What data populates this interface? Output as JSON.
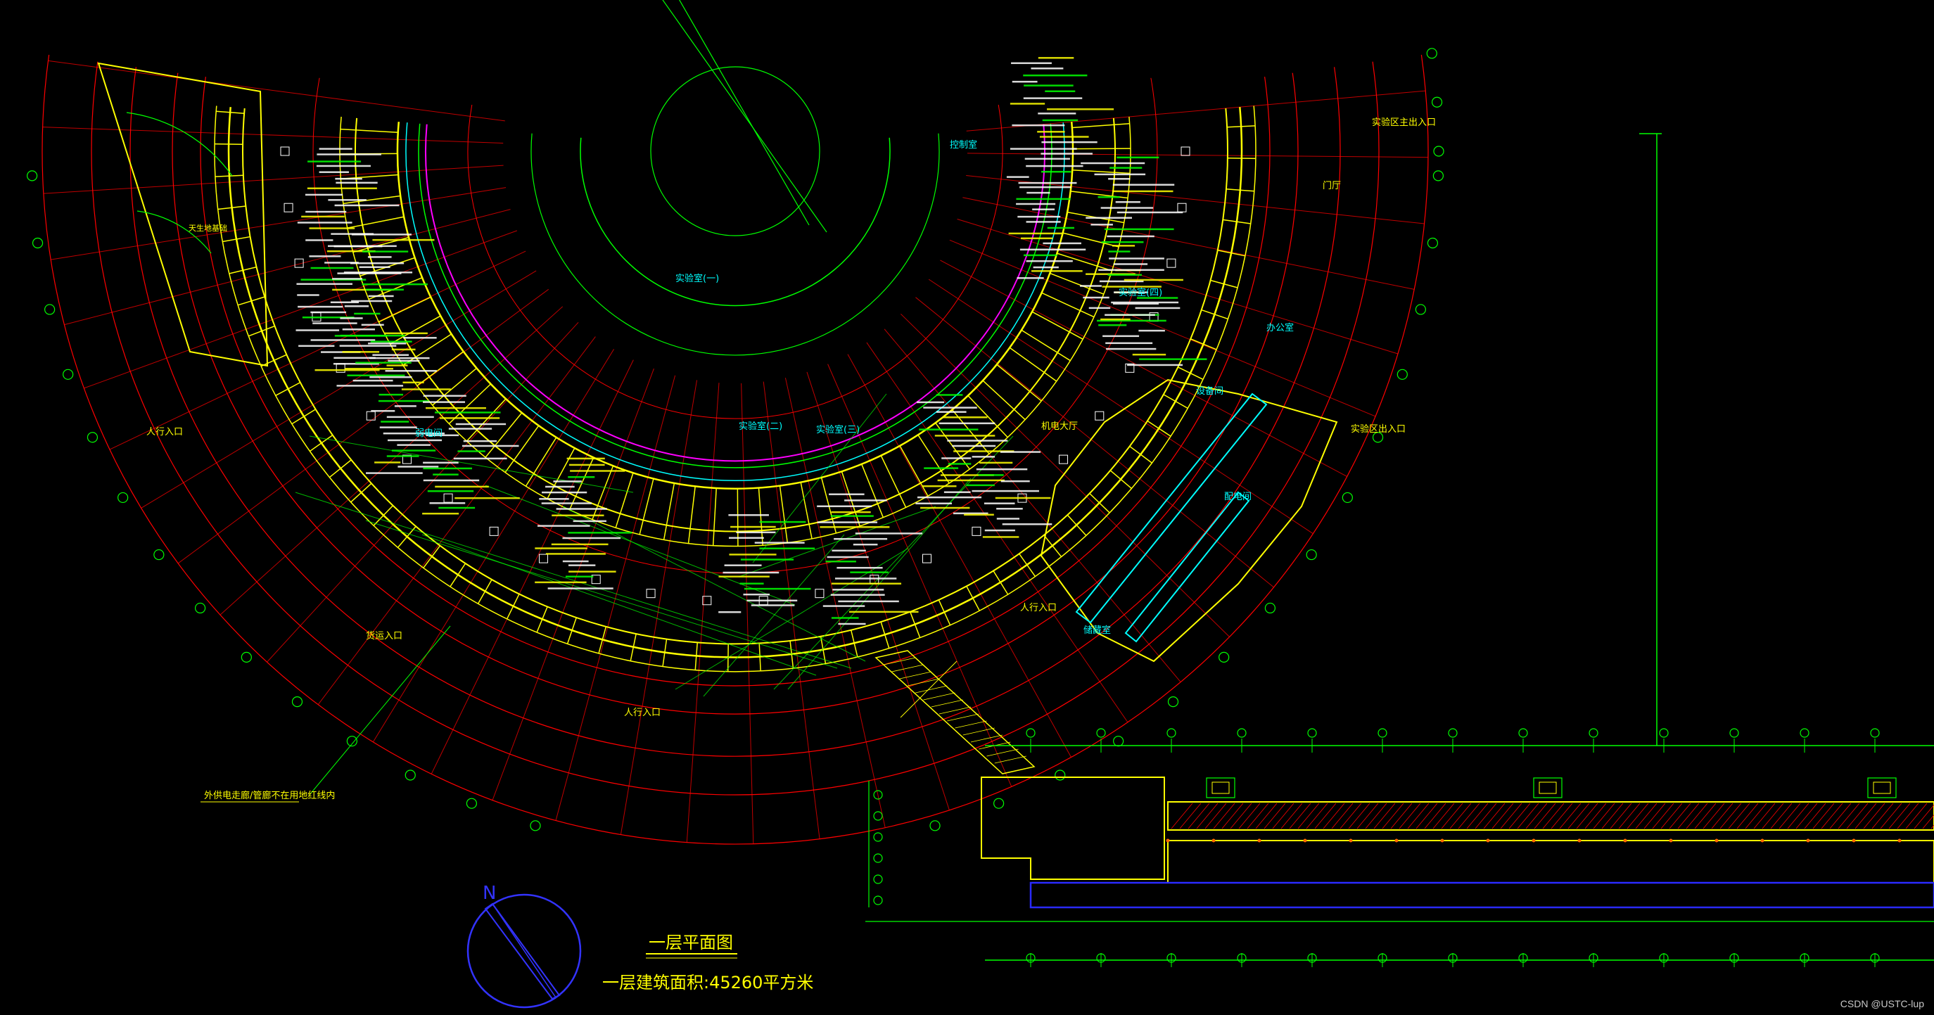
{
  "drawing": {
    "title": "一层平面图",
    "area_note": "一层建筑面积:45260平方米",
    "north_label": "N",
    "watermark": "CSDN @USTC-lup"
  },
  "room_labels": [
    {
      "text": "人行入口",
      "color": "#ffff00"
    },
    {
      "text": "人行入口",
      "color": "#ffff00"
    },
    {
      "text": "人行入口",
      "color": "#ffff00"
    },
    {
      "text": "货运入口",
      "color": "#ffff00"
    },
    {
      "text": "实验区主出入口",
      "color": "#ffff00"
    },
    {
      "text": "实验区出入口",
      "color": "#ffff00"
    },
    {
      "text": "机电大厅",
      "color": "#ffff00"
    },
    {
      "text": "门厅",
      "color": "#ffff00"
    },
    {
      "text": "实验室(一)",
      "color": "#00ffff"
    },
    {
      "text": "实验室(二)",
      "color": "#00ffff"
    },
    {
      "text": "实验室(三)",
      "color": "#00ffff"
    },
    {
      "text": "实验室(四)",
      "color": "#00ffff"
    },
    {
      "text": "设备间",
      "color": "#00ffff"
    },
    {
      "text": "配电间",
      "color": "#00ffff"
    },
    {
      "text": "控制室",
      "color": "#00ffff"
    },
    {
      "text": "储藏室",
      "color": "#00ffff"
    },
    {
      "text": "办公室",
      "color": "#00ffff"
    },
    {
      "text": "弱电间",
      "color": "#00ffff"
    }
  ],
  "notes": [
    {
      "text": "外供电走廊/管廊不在用地红线内",
      "color": "#ffff00"
    },
    {
      "text": "天生地基础",
      "color": "#ffff00"
    }
  ],
  "palette": {
    "background": "#000000",
    "grid": "#ff0000",
    "wall": "#ffff00",
    "green": "#00ff00",
    "cyan": "#00ffff",
    "magenta": "#ff00ff",
    "white": "#ffffff",
    "compass": "#3333ff"
  }
}
